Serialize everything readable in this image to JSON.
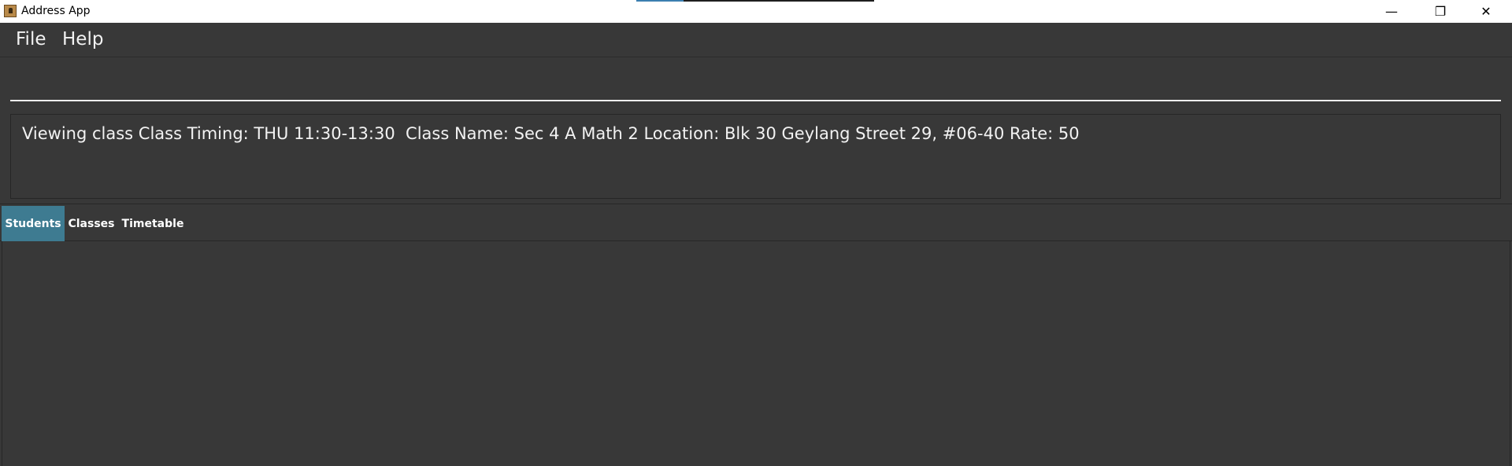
{
  "window": {
    "title": "Address App",
    "controls": {
      "minimize": "—",
      "maximize": "❐",
      "close": "✕"
    }
  },
  "menu": {
    "items": [
      {
        "label": "File"
      },
      {
        "label": "Help"
      }
    ]
  },
  "command": {
    "value": "",
    "placeholder": ""
  },
  "result": {
    "text": "Viewing class Class Timing: THU 11:30-13:30  Class Name: Sec 4 A Math 2 Location: Blk 30 Geylang Street 29, #06-40 Rate: 50"
  },
  "tabs": [
    {
      "label": "Students",
      "selected": true
    },
    {
      "label": "Classes",
      "selected": false
    },
    {
      "label": "Timetable",
      "selected": false
    }
  ],
  "colors": {
    "background": "#383838",
    "selected_tab": "#3e7b91",
    "text": "#f2f2f2"
  },
  "icons": {
    "app": "address-book-icon"
  }
}
